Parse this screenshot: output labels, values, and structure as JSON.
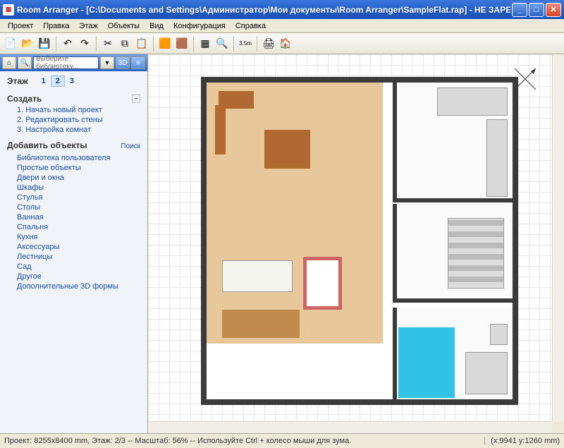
{
  "title": "Room Arranger - [C:\\Documents and Settings\\Администратор\\Мои документы\\Room Arranger\\SampleFlat.rap] - НЕ ЗАРЕГИСТРИРО...",
  "menu": [
    "Проект",
    "Правка",
    "Этаж",
    "Объекты",
    "Вид",
    "Конфигурация",
    "Справка"
  ],
  "nav": {
    "search_placeholder": "Выберите библиотеку...",
    "btn_3d": "3D"
  },
  "floors": {
    "label": "Этаж",
    "tabs": [
      "1",
      "2",
      "3"
    ],
    "active": 1
  },
  "create": {
    "label": "Создать",
    "items": [
      "Начать новый проект",
      "Редактировать стены",
      "Настройка комнат"
    ]
  },
  "add_objects": {
    "label": "Добавить объекты",
    "search": "Поиск",
    "items": [
      "Библиотека пользователя",
      "Простые объекты",
      "Двери и окна",
      "Шкафы",
      "Стулья",
      "Столы",
      "Ванная",
      "Спальня",
      "Кухня",
      "Аксессуары",
      "Лестницы",
      "Сад",
      "Другое",
      "Дополнительные 3D формы"
    ]
  },
  "status": {
    "left": "Проект: 8255x8400 mm, Этаж: 2/3 -- Масштаб: 56% -- Используйте Ctrl + колесо мыши для зума.",
    "right": "(x:9941 y:1260 mm)"
  },
  "toolbar_icons": [
    "new-icon",
    "open-icon",
    "save-icon",
    "sep",
    "undo-icon",
    "redo-icon",
    "sep",
    "cut-icon",
    "copy-icon",
    "paste-icon",
    "sep",
    "cube-icon",
    "cube2-icon",
    "sep",
    "overview-icon",
    "zoom-icon",
    "sep",
    "measure-icon",
    "sep",
    "print-icon",
    "home-icon"
  ]
}
